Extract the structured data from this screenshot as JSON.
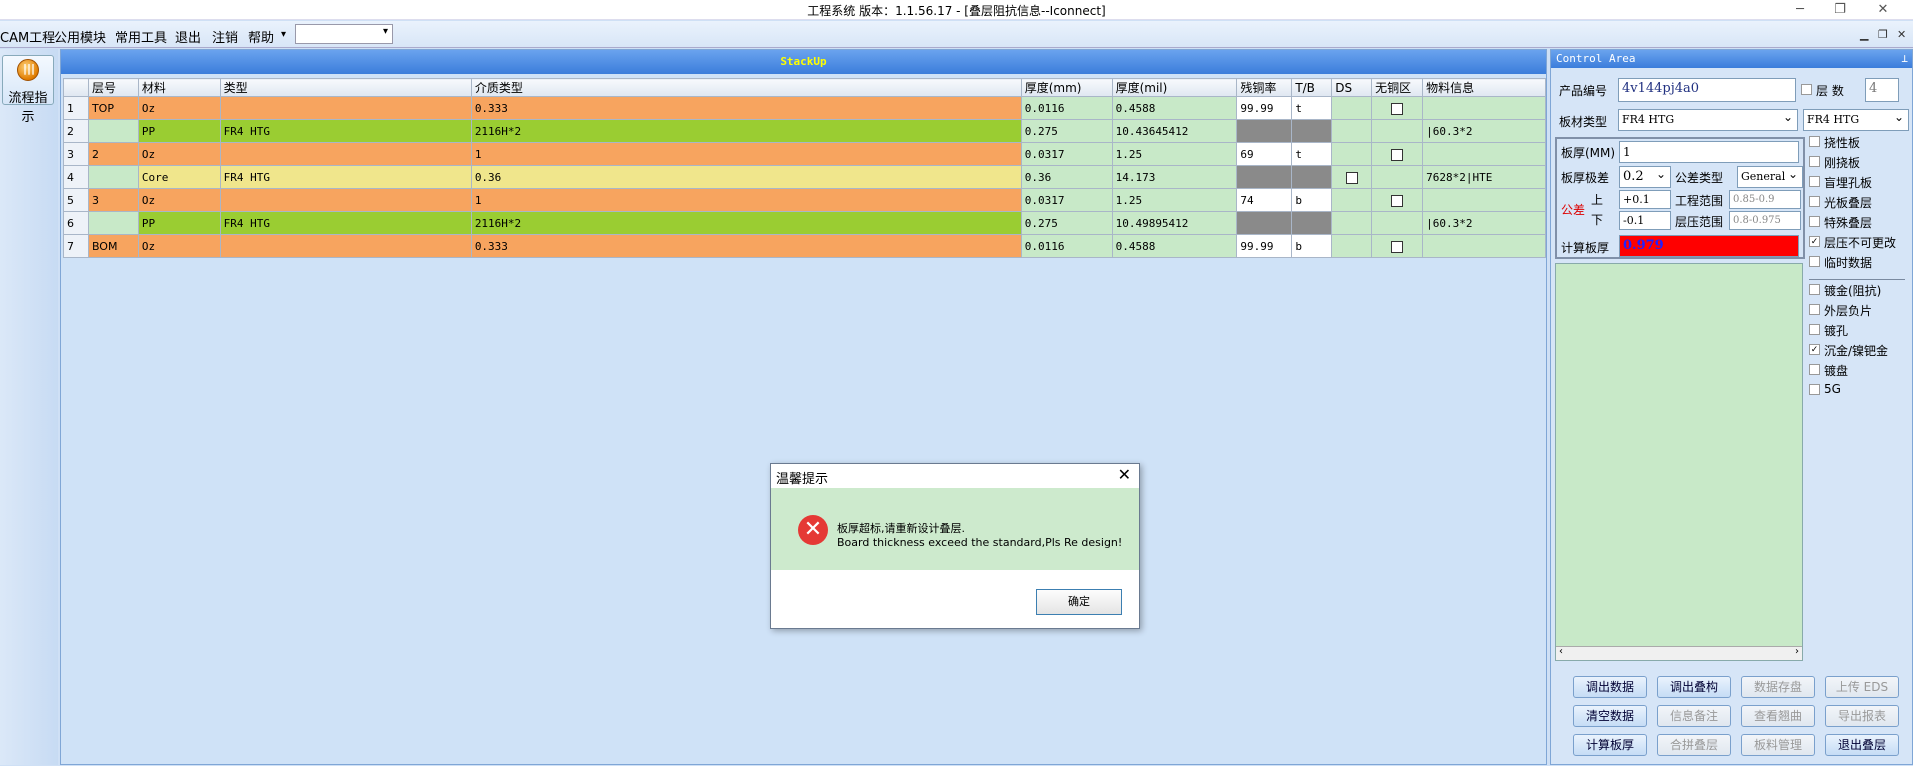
{
  "window": {
    "title": "工程系统  版本：1.1.56.17 - [叠层阻抗信息--Iconnect]"
  },
  "menu": {
    "items": [
      "CAM工程",
      "公用模块",
      "常用工具",
      "退出",
      "注销",
      "帮助"
    ]
  },
  "left": {
    "flow_label": "流程指示"
  },
  "stack": {
    "title": "StackUp",
    "columns": [
      "",
      "层号",
      "材料",
      "类型",
      "介质类型",
      "厚度(mm)",
      "厚度(mil)",
      "残铜率",
      "T/B",
      "DS",
      "无铜区",
      "物料信息"
    ],
    "rows": [
      {
        "n": "1",
        "layer": "TOP",
        "mat": "Oz",
        "type": "",
        "diel": "0.333",
        "mm": "0.0116",
        "mil": "0.4588",
        "cu": "99.99",
        "tb": "t",
        "info": ""
      },
      {
        "n": "2",
        "layer": "",
        "mat": "PP",
        "type": "FR4 HTG",
        "diel": "2116H*2",
        "mm": "0.275",
        "mil": "10.43645412",
        "cu": "",
        "tb": "",
        "info": "|60.3*2"
      },
      {
        "n": "3",
        "layer": "2",
        "mat": "Oz",
        "type": "",
        "diel": "1",
        "mm": "0.0317",
        "mil": "1.25",
        "cu": "69",
        "tb": "t",
        "info": ""
      },
      {
        "n": "4",
        "layer": "",
        "mat": "Core",
        "type": "FR4 HTG",
        "diel": "0.36",
        "mm": "0.36",
        "mil": "14.173",
        "cu": "",
        "tb": "",
        "info": "7628*2|HTE"
      },
      {
        "n": "5",
        "layer": "3",
        "mat": "Oz",
        "type": "",
        "diel": "1",
        "mm": "0.0317",
        "mil": "1.25",
        "cu": "74",
        "tb": "b",
        "info": ""
      },
      {
        "n": "6",
        "layer": "",
        "mat": "PP",
        "type": "FR4 HTG",
        "diel": "2116H*2",
        "mm": "0.275",
        "mil": "10.49895412",
        "cu": "",
        "tb": "",
        "info": "|60.3*2"
      },
      {
        "n": "7",
        "layer": "BOM",
        "mat": "Oz",
        "type": "",
        "diel": "0.333",
        "mm": "0.0116",
        "mil": "0.4588",
        "cu": "99.99",
        "tb": "b",
        "info": ""
      }
    ]
  },
  "dialog": {
    "title": "温馨提示",
    "msg_cn": "板厚超标,请重新设计叠层.",
    "msg_en": "Board thickness exceed the standard,Pls Re design!",
    "ok": "确定"
  },
  "control": {
    "title": "Control Area",
    "product_label": "产品编号",
    "product_value": "4v144pj4a0",
    "layers_label": "层 数",
    "layers_value": "4",
    "material_label": "板材类型",
    "material_value": "FR4 HTG",
    "material_value2": "FR4 HTG",
    "thick_label": "板厚(MM)",
    "thick_value": "1",
    "tol_label": "板厚极差",
    "tol_value": "0.2",
    "toltype_label": "公差类型",
    "toltype_value": "General",
    "gongcha": "公差",
    "up": "上",
    "down": "下",
    "up_value": "+0.1",
    "down_value": "-0.1",
    "eng_range_label": "工程范围",
    "eng_range_value": "0.85-0.9",
    "press_range_label": "层压范围",
    "press_range_value": "0.8-0.975",
    "calc_label": "计算板厚",
    "calc_value": "0.979",
    "checks": [
      {
        "label": "挠性板",
        "checked": false
      },
      {
        "label": "刚挠板",
        "checked": false
      },
      {
        "label": "盲埋孔板",
        "checked": false
      },
      {
        "label": "光板叠层",
        "checked": false
      },
      {
        "label": "特殊叠层",
        "checked": false
      },
      {
        "label": "层压不可更改",
        "checked": true
      },
      {
        "label": "临时数据",
        "checked": false
      },
      {
        "label": "镀金(阻抗)",
        "checked": false
      },
      {
        "label": "外层负片",
        "checked": false
      },
      {
        "label": "镀孔",
        "checked": false
      },
      {
        "label": "沉金/镍钯金",
        "checked": true
      },
      {
        "label": "镀盘",
        "checked": false
      },
      {
        "label": "5G",
        "checked": false
      }
    ],
    "buttons": [
      {
        "label": "调出数据",
        "disabled": false
      },
      {
        "label": "调出叠构",
        "disabled": false
      },
      {
        "label": "数据存盘",
        "disabled": true
      },
      {
        "label": "上传 EDS",
        "disabled": true
      },
      {
        "label": "清空数据",
        "disabled": false
      },
      {
        "label": "信息备注",
        "disabled": true
      },
      {
        "label": "查看翘曲",
        "disabled": true
      },
      {
        "label": "导出报表",
        "disabled": true
      },
      {
        "label": "计算板厚",
        "disabled": false
      },
      {
        "label": "合拼叠层",
        "disabled": true
      },
      {
        "label": "板料管理",
        "disabled": true
      },
      {
        "label": "退出叠层",
        "disabled": false
      }
    ]
  }
}
